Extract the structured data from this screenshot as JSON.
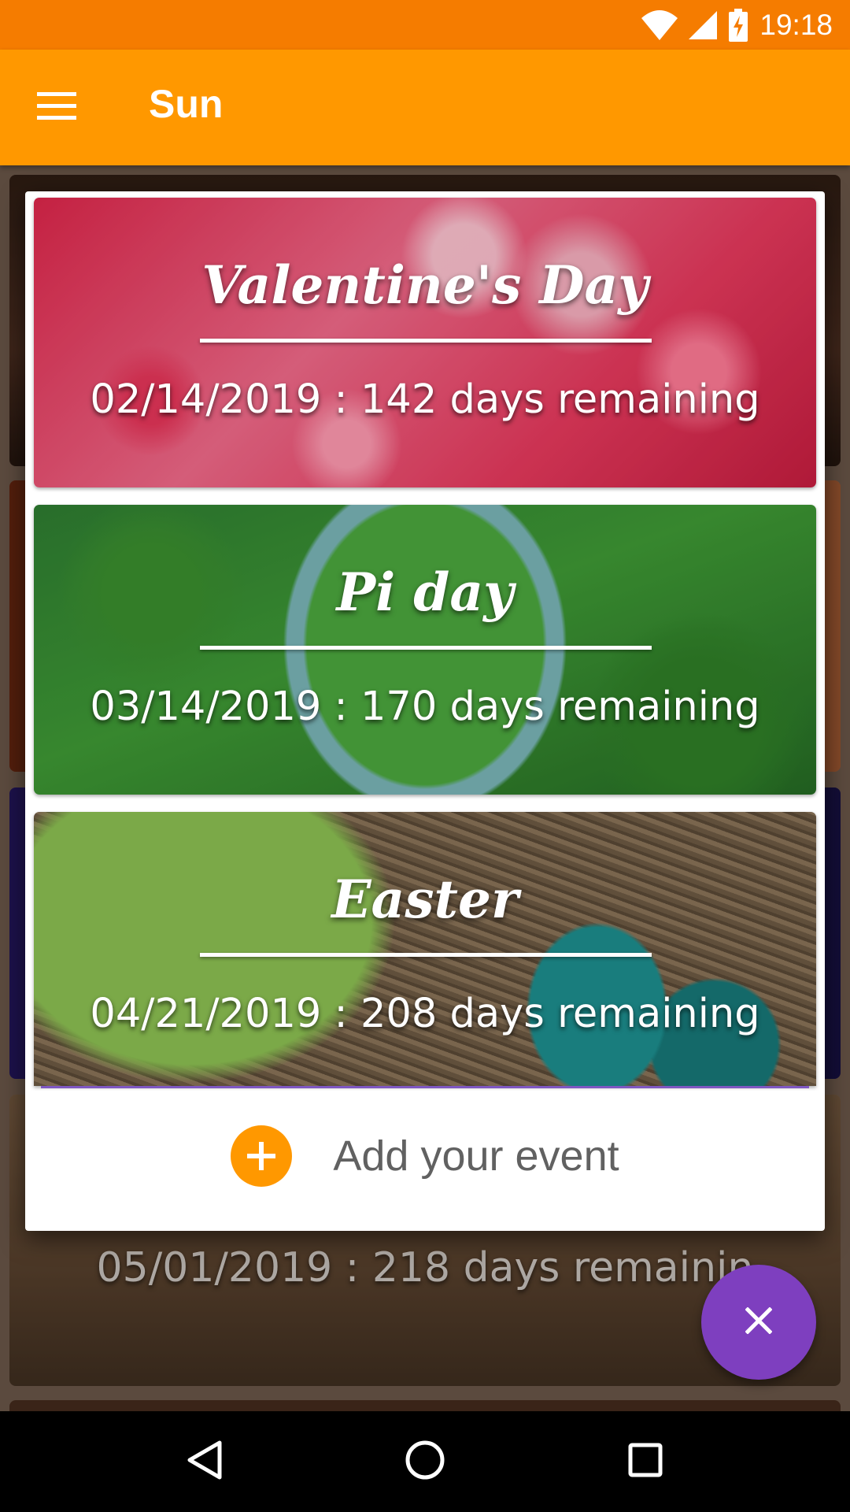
{
  "status_bar": {
    "time": "19:18",
    "icons": [
      "wifi-icon",
      "signal-icon",
      "battery-charging-icon"
    ]
  },
  "app_bar": {
    "title": "Sun",
    "menu_icon": "hamburger-menu-icon"
  },
  "events": [
    {
      "title": "Valentine's Day",
      "date_line": "02/14/2019 : 142 days remaining"
    },
    {
      "title": "Pi day",
      "date_line": "03/14/2019 : 170 days remaining"
    },
    {
      "title": "Easter",
      "date_line": "04/21/2019 : 208 days remaining"
    }
  ],
  "add_event": {
    "label": "Add your event",
    "icon": "add-circle-icon"
  },
  "background_list": {
    "partial_date_line": "05/01/2019 : 218 days remainin"
  },
  "fab": {
    "icon": "close-icon"
  },
  "nav_bar": {
    "icons": [
      "back-icon",
      "home-icon",
      "recents-icon"
    ]
  },
  "colors": {
    "status_bar": "#f57c00",
    "app_bar": "#ff9800",
    "accent": "#ff9800",
    "fab": "#7e3fbf"
  }
}
